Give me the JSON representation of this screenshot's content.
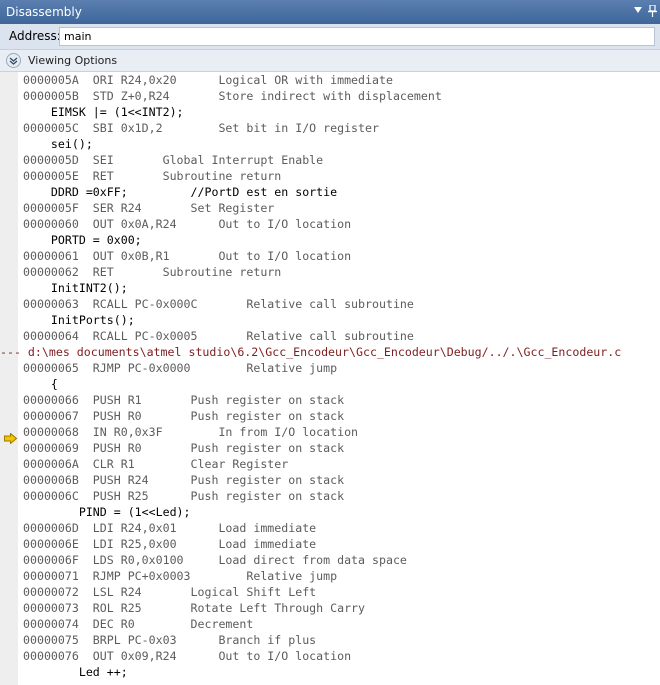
{
  "window": {
    "title": "Disassembly"
  },
  "address": {
    "label": "Address:",
    "value": "main"
  },
  "viewing_options": {
    "label": "Viewing Options"
  },
  "colors": {
    "title_bar": "#3f6699",
    "asm_text": "#5c5c5c",
    "source_text": "#000000",
    "file_path": "#7f1d1d",
    "arrow": "#f5c400"
  },
  "lines": [
    {
      "kind": "asm",
      "text": "0000005A  ORI R24,0x20      Logical OR with immediate"
    },
    {
      "kind": "asm",
      "text": "0000005B  STD Z+0,R24       Store indirect with displacement"
    },
    {
      "kind": "src",
      "text": "    EIMSK |= (1<<INT2);"
    },
    {
      "kind": "asm",
      "text": "0000005C  SBI 0x1D,2        Set bit in I/O register"
    },
    {
      "kind": "src",
      "text": "    sei();"
    },
    {
      "kind": "asm",
      "text": "0000005D  SEI       Global Interrupt Enable"
    },
    {
      "kind": "asm",
      "text": "0000005E  RET       Subroutine return"
    },
    {
      "kind": "src",
      "text": "    DDRD =0xFF;         //PortD est en sortie"
    },
    {
      "kind": "asm",
      "text": "0000005F  SER R24       Set Register"
    },
    {
      "kind": "asm",
      "text": "00000060  OUT 0x0A,R24      Out to I/O location"
    },
    {
      "kind": "src",
      "text": "    PORTD = 0x00;"
    },
    {
      "kind": "asm",
      "text": "00000061  OUT 0x0B,R1       Out to I/O location"
    },
    {
      "kind": "asm",
      "text": "00000062  RET       Subroutine return"
    },
    {
      "kind": "src",
      "text": "    InitINT2();"
    },
    {
      "kind": "asm",
      "text": "00000063  RCALL PC-0x000C       Relative call subroutine"
    },
    {
      "kind": "src",
      "text": "    InitPorts();"
    },
    {
      "kind": "asm",
      "text": "00000064  RCALL PC-0x0005       Relative call subroutine"
    },
    {
      "kind": "file",
      "text": "--- d:\\mes documents\\atmel studio\\6.2\\Gcc_Encodeur\\Gcc_Encodeur\\Debug/../.\\Gcc_Encodeur.c"
    },
    {
      "kind": "asm",
      "text": "00000065  RJMP PC-0x0000        Relative jump"
    },
    {
      "kind": "src",
      "text": "    {"
    },
    {
      "kind": "asm",
      "text": "00000066  PUSH R1       Push register on stack"
    },
    {
      "kind": "asm",
      "text": "00000067  PUSH R0       Push register on stack"
    },
    {
      "kind": "asm",
      "text": "00000068  IN R0,0x3F        In from I/O location"
    },
    {
      "kind": "asm",
      "text": "00000069  PUSH R0       Push register on stack"
    },
    {
      "kind": "asm",
      "text": "0000006A  CLR R1        Clear Register"
    },
    {
      "kind": "asm",
      "text": "0000006B  PUSH R24      Push register on stack"
    },
    {
      "kind": "asm",
      "text": "0000006C  PUSH R25      Push register on stack"
    },
    {
      "kind": "src",
      "text": "        PIND = (1<<Led);"
    },
    {
      "kind": "asm",
      "text": "0000006D  LDI R24,0x01      Load immediate"
    },
    {
      "kind": "asm",
      "text": "0000006E  LDI R25,0x00      Load immediate"
    },
    {
      "kind": "asm",
      "text": "0000006F  LDS R0,0x0100     Load direct from data space"
    },
    {
      "kind": "asm",
      "text": "00000071  RJMP PC+0x0003        Relative jump"
    },
    {
      "kind": "asm",
      "text": "00000072  LSL R24       Logical Shift Left"
    },
    {
      "kind": "asm",
      "text": "00000073  ROL R25       Rotate Left Through Carry"
    },
    {
      "kind": "asm",
      "text": "00000074  DEC R0        Decrement"
    },
    {
      "kind": "asm",
      "text": "00000075  BRPL PC-0x03      Branch if plus"
    },
    {
      "kind": "asm",
      "text": "00000076  OUT 0x09,R24      Out to I/O location"
    },
    {
      "kind": "src",
      "text": "        Led ++;"
    }
  ]
}
